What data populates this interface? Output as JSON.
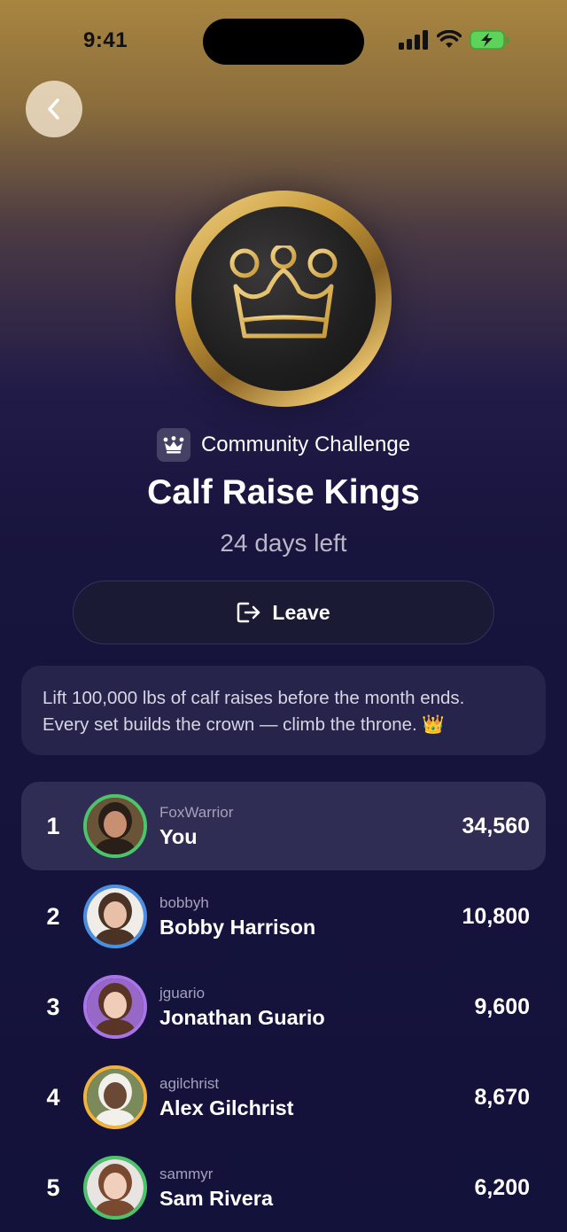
{
  "status": {
    "time": "9:41"
  },
  "challenge": {
    "type_label": "Community Challenge",
    "title": "Calf Raise Kings",
    "days_left": "24 days left",
    "leave_label": "Leave",
    "description_line1": "Lift 100,000 lbs of calf raises before the month ends.",
    "description_line2": "Every set builds the crown — climb the throne. 👑"
  },
  "colors": {
    "gold": "#d4a84a",
    "highlight_row": "#302d54",
    "background_dark": "#13123a"
  },
  "leaderboard": [
    {
      "rank": "1",
      "username": "FoxWarrior",
      "display": "You",
      "score": "34,560",
      "ring": "#4cc46a",
      "skin": "#c89070",
      "hair": "#2a1e18",
      "bg": "#6a5438"
    },
    {
      "rank": "2",
      "username": "bobbyh",
      "display": "Bobby Harrison",
      "score": "10,800",
      "ring": "#4a90e2",
      "skin": "#e8c0a8",
      "hair": "#4a3224",
      "bg": "#f0ece8"
    },
    {
      "rank": "3",
      "username": "jguario",
      "display": "Jonathan Guario",
      "score": "9,600",
      "ring": "#a874e8",
      "skin": "#f0cdb8",
      "hair": "#5a3424",
      "bg": "#9868c8"
    },
    {
      "rank": "4",
      "username": "agilchrist",
      "display": "Alex Gilchrist",
      "score": "8,670",
      "ring": "#f2b23a",
      "skin": "#6a4a34",
      "hair": "#f2f0ea",
      "bg": "#7a8a5a"
    },
    {
      "rank": "5",
      "username": "sammyr",
      "display": "Sam Rivera",
      "score": "6,200",
      "ring": "#4cc46a",
      "skin": "#f0d0bc",
      "hair": "#7a4a30",
      "bg": "#e8e4e2"
    }
  ]
}
